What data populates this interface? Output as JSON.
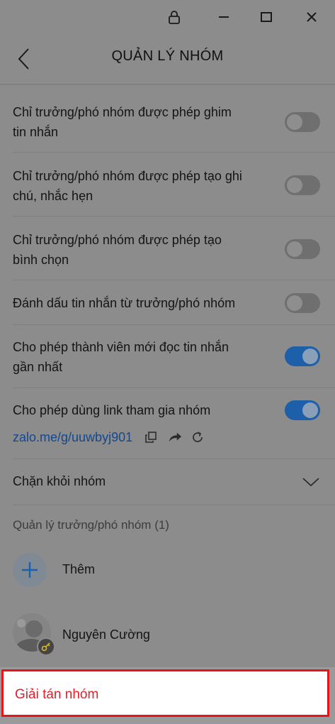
{
  "window": {
    "controls": [
      "lock-icon",
      "minimize-icon",
      "maximize-icon",
      "close-icon"
    ]
  },
  "header": {
    "title": "QUẢN LÝ NHÓM"
  },
  "settings": [
    {
      "label_line1": "Chỉ trưởng/phó nhóm được phép ghim",
      "label_line2": "tin nhắn",
      "enabled": false
    },
    {
      "label_line1": "Chỉ trưởng/phó nhóm được phép tạo ghi",
      "label_line2": "chú, nhắc hẹn",
      "enabled": false
    },
    {
      "label_line1": "Chỉ trưởng/phó nhóm được phép tạo",
      "label_line2": "bình chọn",
      "enabled": false
    },
    {
      "label_line1": "Đánh dấu tin nhắn từ trưởng/phó nhóm",
      "label_line2": "",
      "enabled": false
    },
    {
      "label_line1": "Cho phép thành viên mới đọc tin nhắn",
      "label_line2": "gần nhất",
      "enabled": true
    },
    {
      "label_line1": "Cho phép dùng link tham gia nhóm",
      "label_line2": "",
      "enabled": true
    }
  ],
  "join_link": {
    "url": "zalo.me/g/uuwbyj901",
    "actions": [
      "copy-icon",
      "share-icon",
      "refresh-icon"
    ]
  },
  "block_section": {
    "label": "Chặn khỏi nhóm"
  },
  "admins": {
    "title": "Quản lý trưởng/phó nhóm (1)",
    "add_label": "Thêm",
    "members": [
      {
        "name": "Nguyên Cường"
      }
    ]
  },
  "footer": {
    "disband_label": "Giải tán nhóm",
    "highlight_color": "#e8141c"
  },
  "colors": {
    "toggle_on": "#1d5fa8",
    "link": "#14488e",
    "danger_text": "#e0202a"
  }
}
